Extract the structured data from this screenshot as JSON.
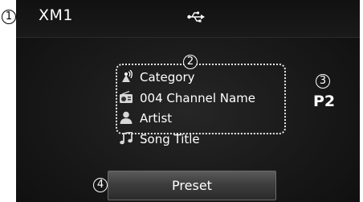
{
  "header": {
    "band": "XM1",
    "usb_icon": "usb-icon"
  },
  "callouts": {
    "c1": "1",
    "c2": "2",
    "c3": "3",
    "c4": "4"
  },
  "info": {
    "category": "Category",
    "channel": "004 Channel Name",
    "artist": "Artist",
    "song": "Song Title"
  },
  "preset_number": "P2",
  "preset_button": "Preset",
  "icons": {
    "category": "antenna-icon",
    "channel": "radio-icon",
    "artist": "person-icon",
    "song": "music-note-icon"
  }
}
